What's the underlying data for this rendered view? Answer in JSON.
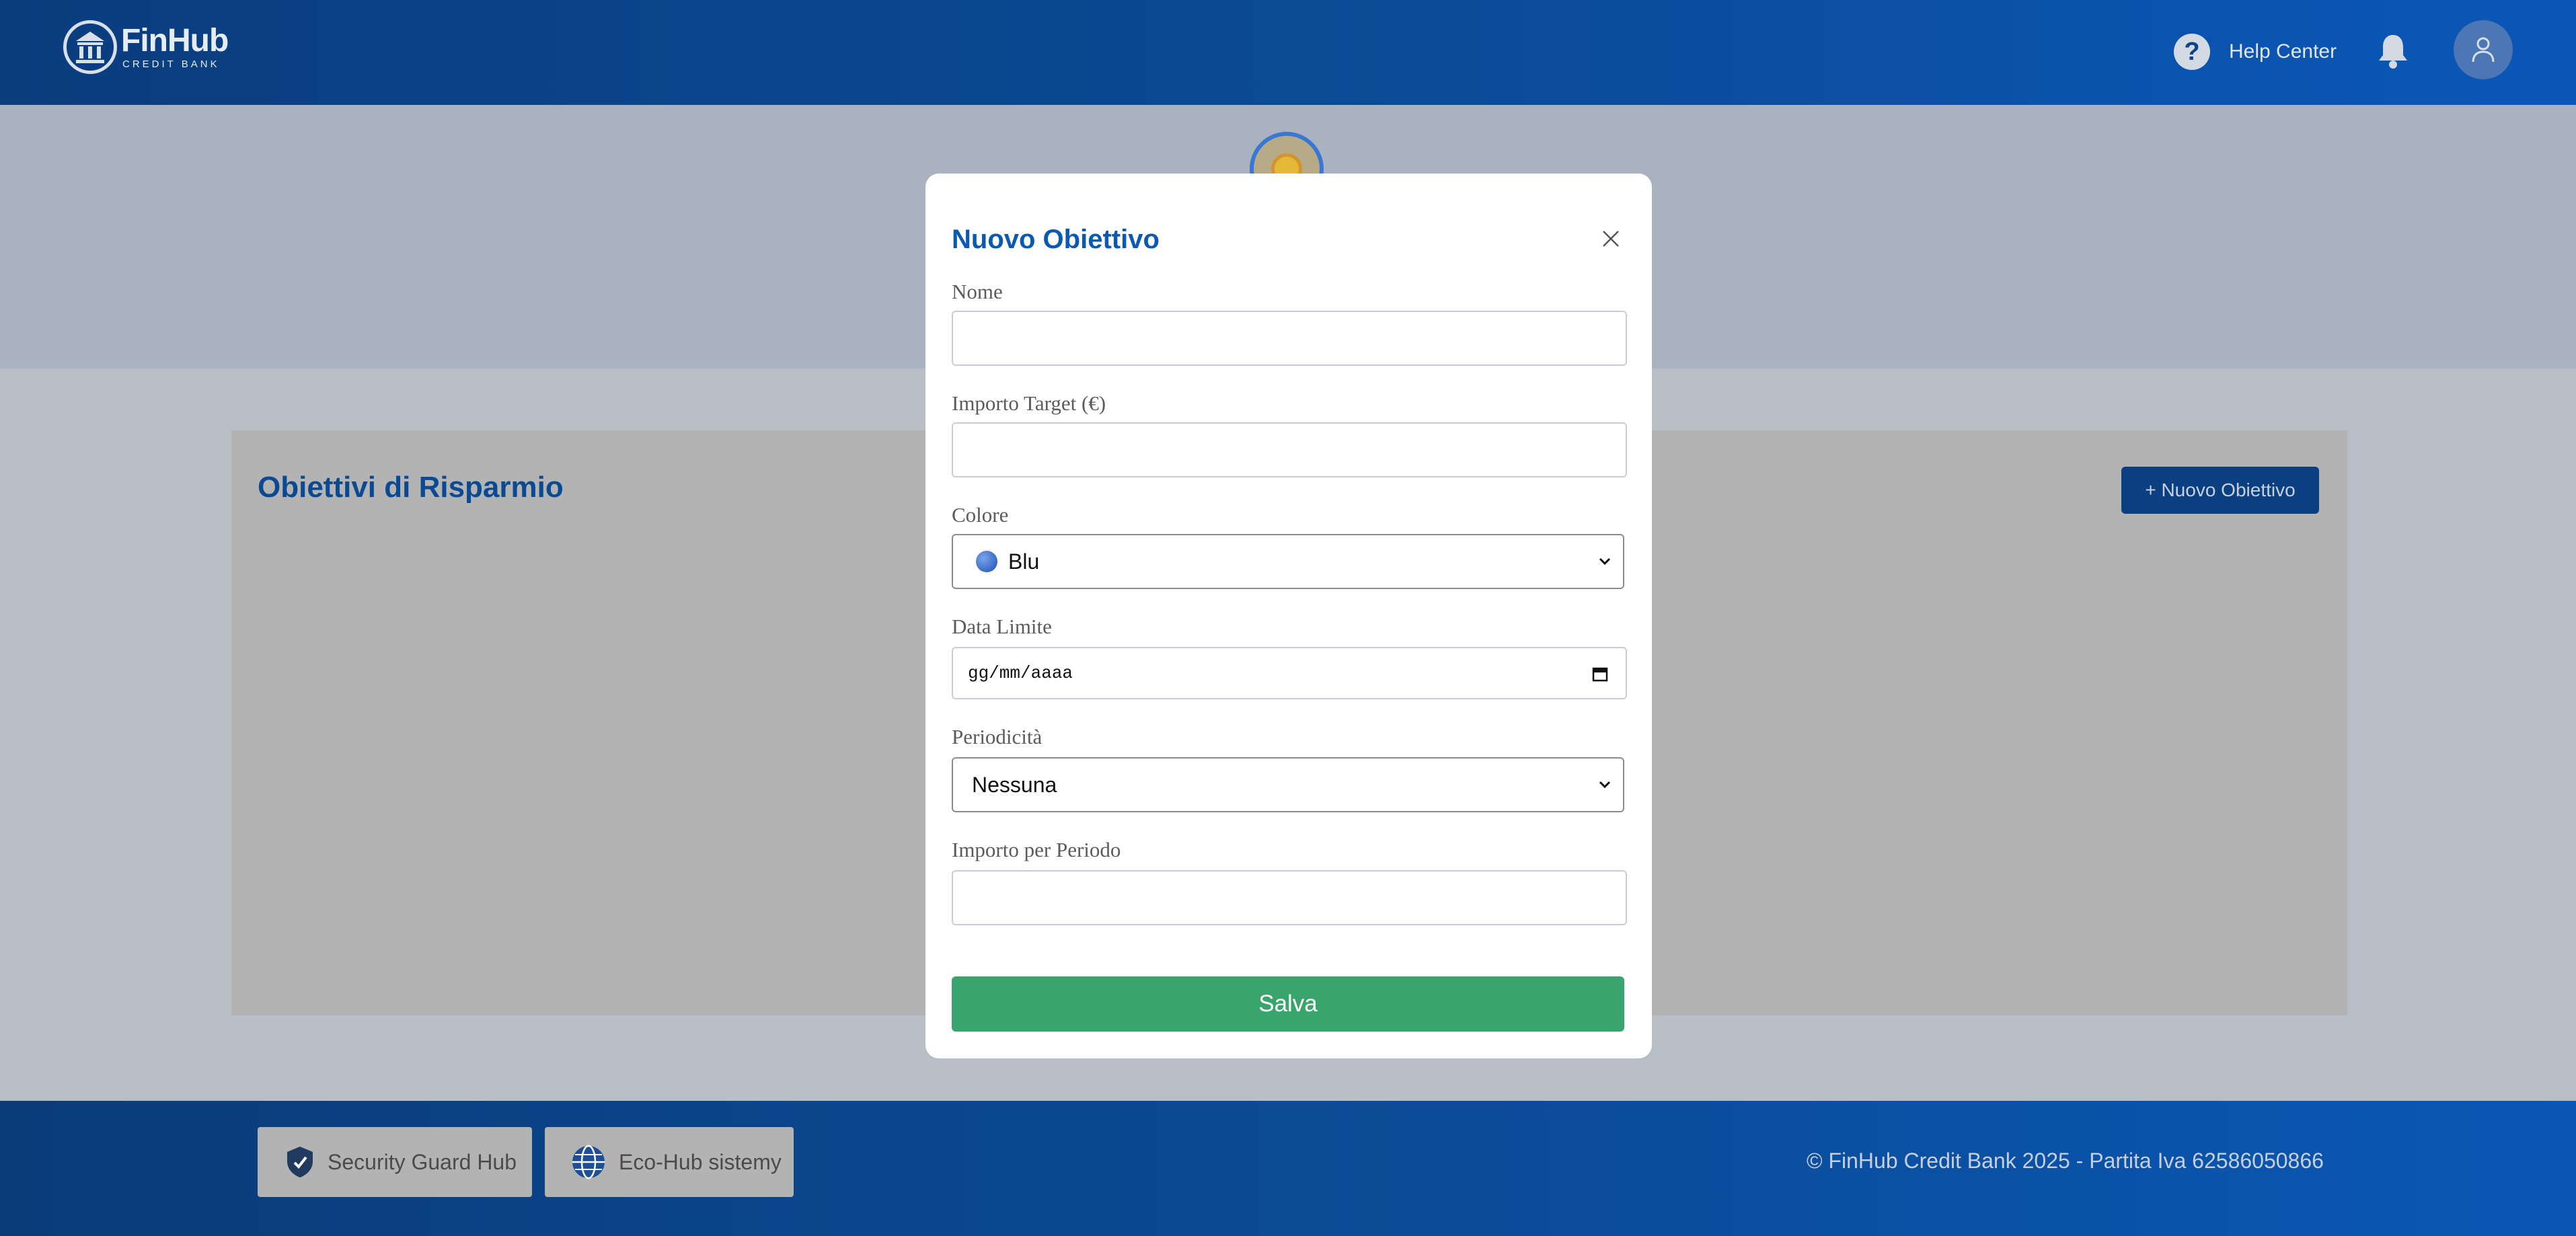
{
  "header": {
    "brand_name": "FinHub",
    "brand_sub": "CREDIT BANK",
    "help_label": "Help Center"
  },
  "page": {
    "title": "Obiettivi di Risparmio",
    "new_goal_button": "+ Nuovo Obiettivo"
  },
  "modal": {
    "title": "Nuovo Obiettivo",
    "fields": {
      "nome": {
        "label": "Nome",
        "value": ""
      },
      "importo_target": {
        "label": "Importo Target (€)",
        "value": ""
      },
      "colore": {
        "label": "Colore",
        "value": "Blu",
        "swatch_color": "#1b4fb0"
      },
      "data_limite": {
        "label": "Data Limite",
        "value": "gg/mm/aaaa"
      },
      "periodicita": {
        "label": "Periodicità",
        "value": "Nessuna"
      },
      "importo_periodo": {
        "label": "Importo per Periodo",
        "value": ""
      }
    },
    "save_button": "Salva"
  },
  "footer": {
    "btn_security": "Security Guard Hub",
    "btn_eco": "Eco-Hub sistemy",
    "copyright": "© FinHub Credit Bank 2025 - Partita Iva 62586050866"
  },
  "colors": {
    "primary": "#0b4a94",
    "title_blue": "#0b59b1",
    "save_green": "#39a46b"
  }
}
